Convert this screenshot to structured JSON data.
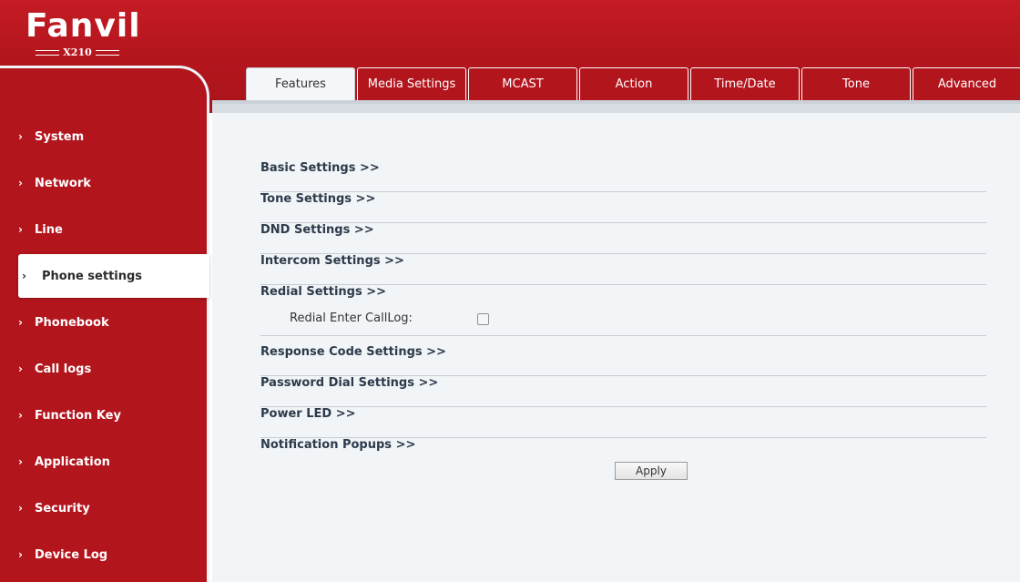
{
  "brand": {
    "name": "Fanvil",
    "model": "X210"
  },
  "sidebar": {
    "items": [
      {
        "label": "System",
        "active": false
      },
      {
        "label": "Network",
        "active": false
      },
      {
        "label": "Line",
        "active": false
      },
      {
        "label": "Phone settings",
        "active": true
      },
      {
        "label": "Phonebook",
        "active": false
      },
      {
        "label": "Call logs",
        "active": false
      },
      {
        "label": "Function Key",
        "active": false
      },
      {
        "label": "Application",
        "active": false
      },
      {
        "label": "Security",
        "active": false
      },
      {
        "label": "Device Log",
        "active": false
      }
    ]
  },
  "tabs": [
    {
      "label": "Features",
      "active": true
    },
    {
      "label": "Media Settings",
      "active": false
    },
    {
      "label": "MCAST",
      "active": false
    },
    {
      "label": "Action",
      "active": false
    },
    {
      "label": "Time/Date",
      "active": false
    },
    {
      "label": "Tone",
      "active": false
    },
    {
      "label": "Advanced",
      "active": false
    }
  ],
  "sections": [
    {
      "label": "Basic Settings >>"
    },
    {
      "label": "Tone Settings >>"
    },
    {
      "label": "DND Settings >>"
    },
    {
      "label": "Intercom Settings >>"
    },
    {
      "label": "Redial Settings >>"
    },
    {
      "label": "Response Code Settings >>"
    },
    {
      "label": "Password Dial Settings >>"
    },
    {
      "label": "Power LED >>"
    },
    {
      "label": "Notification Popups >>"
    }
  ],
  "redial": {
    "field_label": "Redial Enter CallLog:",
    "checked": false
  },
  "apply_label": "Apply",
  "colors": {
    "brand_red": "#b3151d",
    "content_bg": "#f1f5f8"
  }
}
